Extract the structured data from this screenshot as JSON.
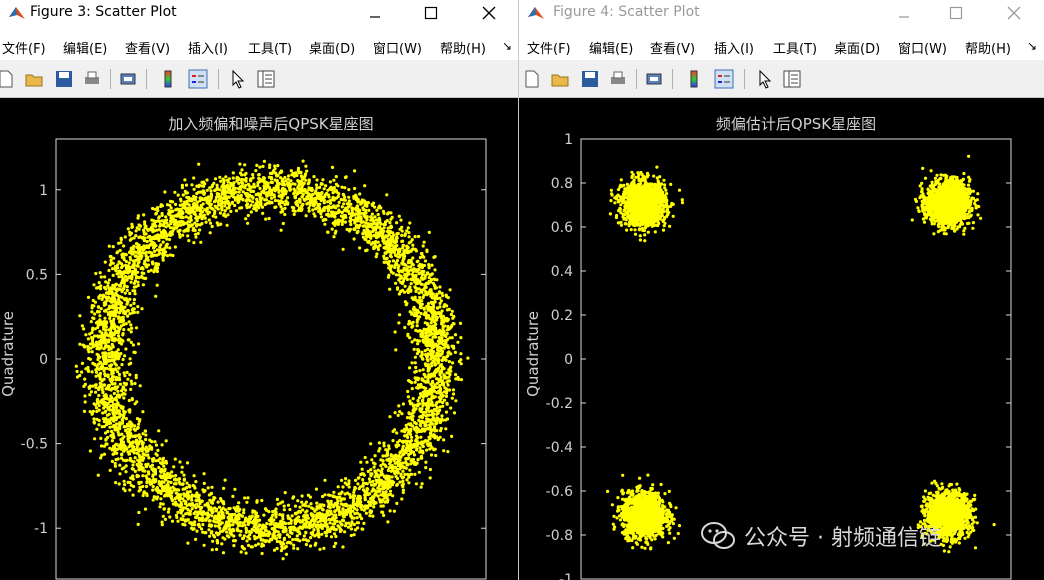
{
  "windows": [
    {
      "title": "Figure 3: Scatter Plot",
      "menu": [
        "文件(F)",
        "编辑(E)",
        "查看(V)",
        "插入(I)",
        "工具(T)",
        "桌面(D)",
        "窗口(W)",
        "帮助(H)"
      ],
      "more": "↘"
    },
    {
      "title": "Figure 4: Scatter Plot",
      "menu": [
        "文件(F)",
        "编辑(E)",
        "查看(V)",
        "插入(I)",
        "工具(T)",
        "桌面(D)",
        "窗口(W)",
        "帮助(H)"
      ],
      "more": "↘"
    }
  ],
  "toolbar_icons": [
    "new-file-icon",
    "open-folder-icon",
    "save-icon",
    "print-icon",
    "print-preview-icon",
    "colorbar-icon",
    "legend-icon",
    "pointer-icon",
    "property-editor-icon"
  ],
  "watermark": {
    "text": "公众号 · 射频通信链",
    "icon": "wechat-icon"
  },
  "colors": {
    "points": "#ffff00",
    "axes_bg": "#000000",
    "axes_line": "#d8d8d8",
    "label": "#d0d0d0"
  },
  "chart_data": [
    {
      "type": "scatter",
      "title": "加入频偏和噪声后QPSK星座图",
      "xlabel": "",
      "ylabel": "Quadrature",
      "xlim": [
        -1.3,
        1.3
      ],
      "ylim": [
        -1.3,
        1.3
      ],
      "yticks": [
        -1,
        -0.5,
        0,
        0.5,
        1
      ],
      "ytick_labels": [
        "-1",
        "-0.5",
        "0",
        "0.5",
        "1"
      ],
      "grid": false,
      "series": [
        {
          "shape": "ring",
          "radius": 1.0,
          "spread": 0.07,
          "count": 5500,
          "color": "#ffff00"
        }
      ]
    },
    {
      "type": "scatter",
      "title": "频偏估计后QPSK星座图",
      "xlabel": "",
      "ylabel": "Quadrature",
      "xlim": [
        -1,
        1
      ],
      "ylim": [
        -1,
        1
      ],
      "yticks": [
        -1,
        -0.8,
        -0.6,
        -0.4,
        -0.2,
        0,
        0.2,
        0.4,
        0.6,
        0.8,
        1
      ],
      "ytick_labels": [
        "-1",
        "-0.8",
        "-0.6",
        "-0.4",
        "-0.2",
        "0",
        "0.2",
        "0.4",
        "0.6",
        "0.8",
        "1"
      ],
      "grid": false,
      "series": [
        {
          "shape": "clusters",
          "centers": [
            [
              -0.707,
              0.707
            ],
            [
              0.707,
              0.707
            ],
            [
              -0.707,
              -0.707
            ],
            [
              0.707,
              -0.707
            ]
          ],
          "spread": 0.05,
          "count_per_cluster": 1400,
          "color": "#ffff00"
        }
      ]
    }
  ]
}
